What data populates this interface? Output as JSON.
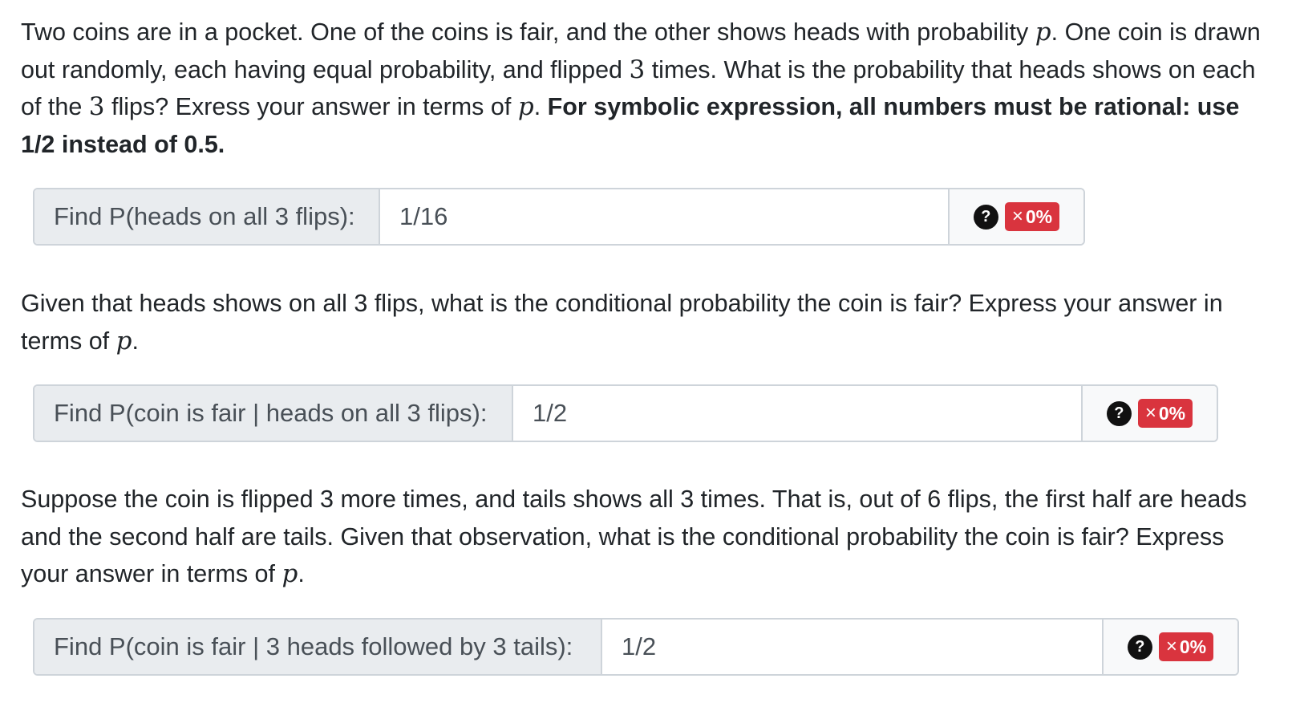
{
  "intro": {
    "t1": "Two coins are in a pocket. One of the coins is fair, and the other shows heads with probability ",
    "var1": "p",
    "t2": ". One coin is drawn out randomly, each having equal probability, and flipped ",
    "num1": "3",
    "t3": " times. What is the probability that heads shows on each of the ",
    "num2": "3",
    "t4": " flips? Exress your answer in terms of ",
    "var2": "p",
    "t5": ". ",
    "bold": "For symbolic expression, all numbers must be rational: use 1/2 instead of 0.5."
  },
  "q1": {
    "label": "Find P(heads on all 3 flips):",
    "value": "1/16",
    "help": "?",
    "badge_x": "×",
    "badge": "0%"
  },
  "p2": {
    "t1": "Given that heads shows on all 3 flips, what is the conditional probability the coin is fair? Express your answer in terms of ",
    "var": "p",
    "t2": "."
  },
  "q2": {
    "label": "Find P(coin is fair | heads on all 3 flips):",
    "value": "1/2",
    "help": "?",
    "badge_x": "×",
    "badge": "0%"
  },
  "p3": {
    "t1": "Suppose the coin is flipped 3 more times, and tails shows all 3 times. That is, out of 6 flips, the first half are heads and the second half are tails. Given that observation, what is the conditional probability the coin is fair? Express your answer in terms of ",
    "var": "p",
    "t2": "."
  },
  "q3": {
    "label": "Find P(coin is fair | 3 heads followed by 3 tails):",
    "value": "1/2",
    "help": "?",
    "badge_x": "×",
    "badge": "0%"
  },
  "colors": {
    "error_badge": "#d9343e",
    "prepend_bg": "#e9ecef",
    "border": "#ced4da"
  }
}
